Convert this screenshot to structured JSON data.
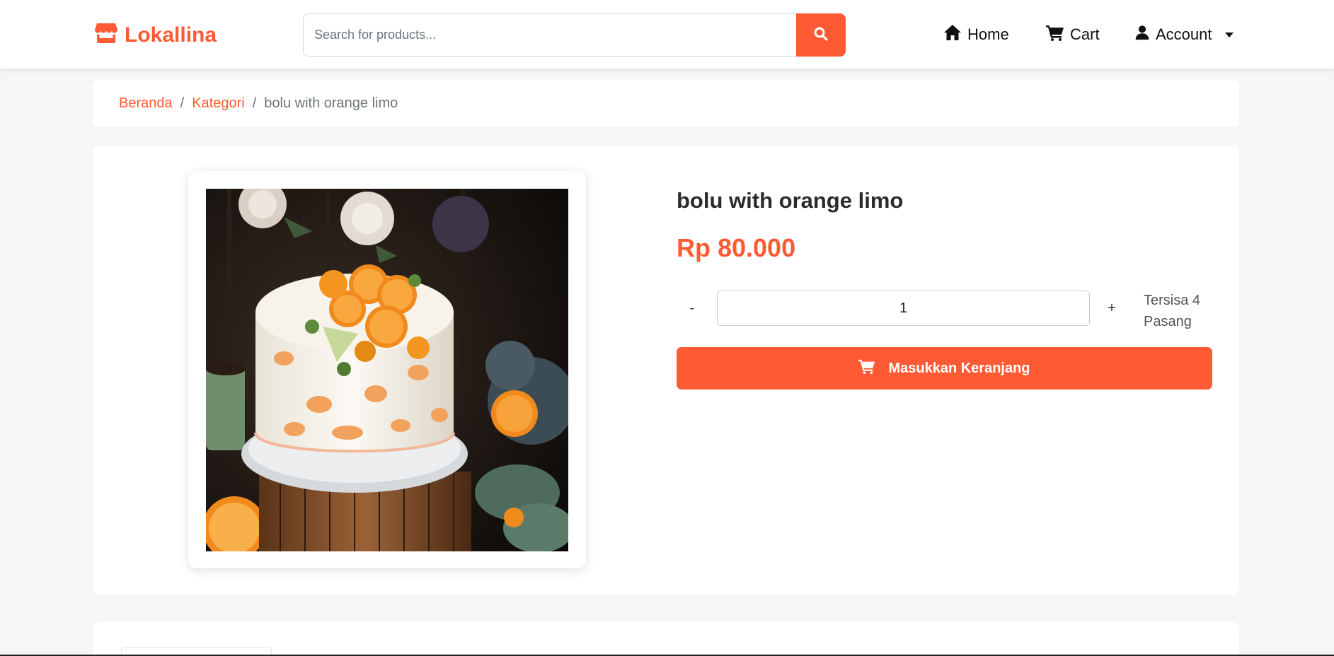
{
  "brand": {
    "name": "Lokallina",
    "icon": "store-icon",
    "color": "#fe5a33"
  },
  "search": {
    "placeholder": "Search for products...",
    "value": "",
    "button_icon": "search-icon"
  },
  "nav": {
    "home": {
      "label": "Home",
      "icon": "home-icon"
    },
    "cart": {
      "label": "Cart",
      "icon": "cart-icon"
    },
    "account": {
      "label": "Account",
      "icon": "user-icon"
    }
  },
  "breadcrumb": {
    "items": [
      "Beranda",
      "Kategori"
    ],
    "separator": "/",
    "current": "bolu with orange limo"
  },
  "product": {
    "title": "bolu with orange limo",
    "price": "Rp 80.000",
    "quantity": "1",
    "minus_label": "-",
    "plus_label": "+",
    "stock_line1": "Tersisa 4",
    "stock_line2": "Pasang",
    "add_to_cart_label": "Masukkan Keranjang",
    "add_to_cart_icon": "cart-icon"
  },
  "colors": {
    "accent": "#fe5a33",
    "background": "#f6f6f7"
  }
}
